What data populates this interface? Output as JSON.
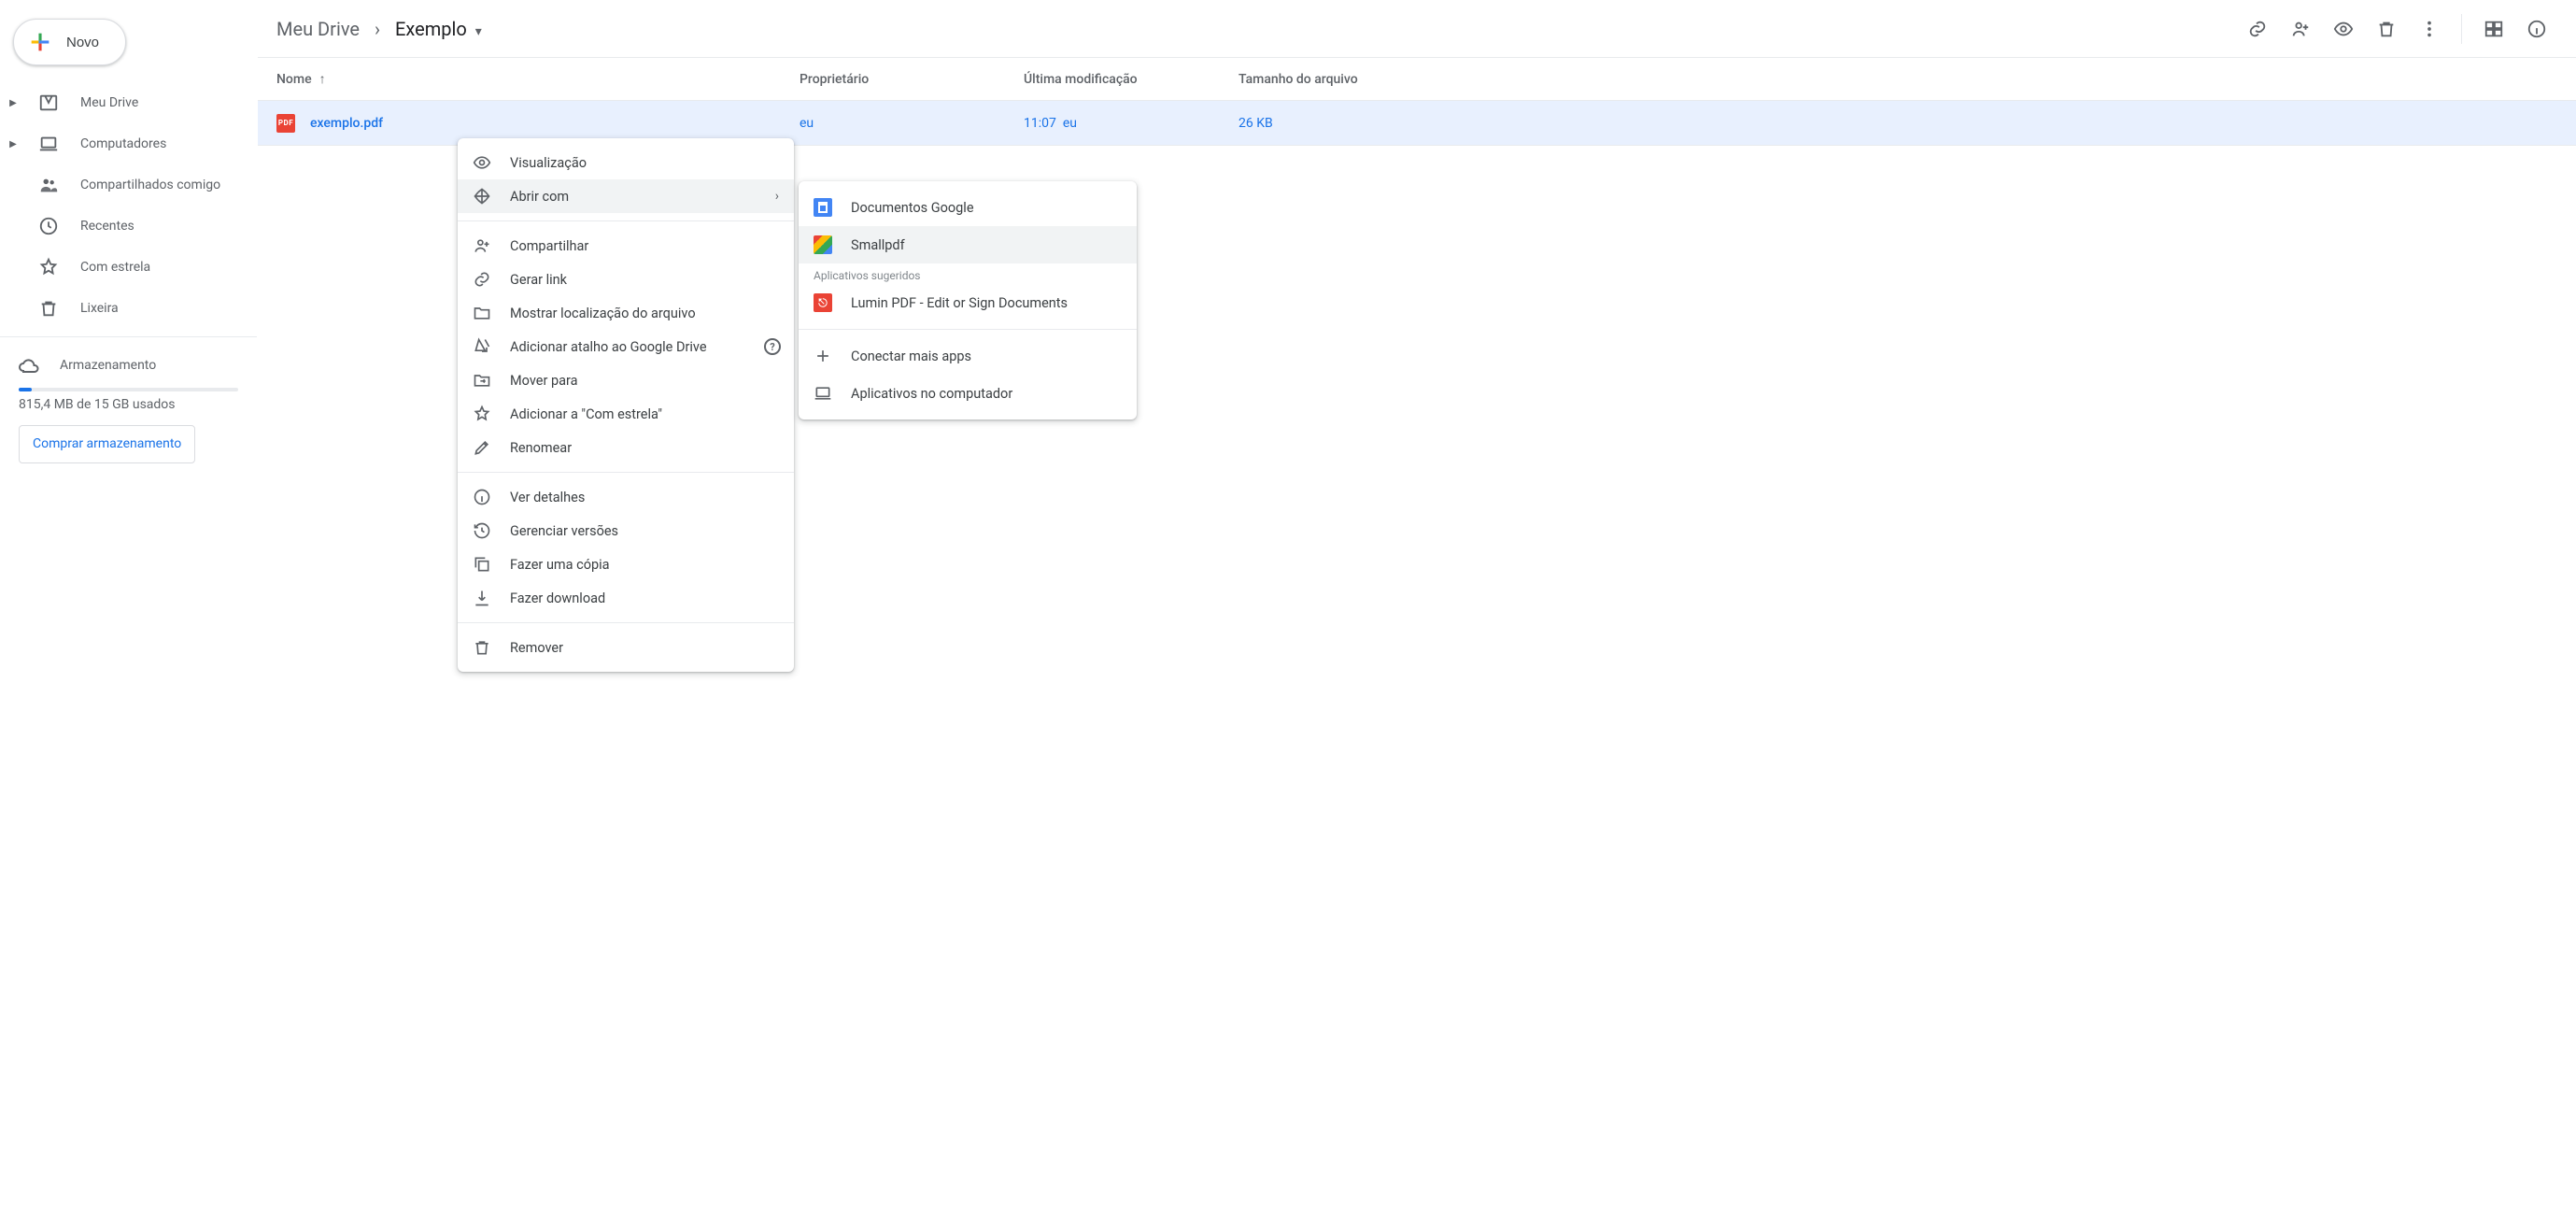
{
  "new_button_label": "Novo",
  "sidebar": {
    "items": [
      {
        "label": "Meu Drive"
      },
      {
        "label": "Computadores"
      },
      {
        "label": "Compartilhados comigo"
      },
      {
        "label": "Recentes"
      },
      {
        "label": "Com estrela"
      },
      {
        "label": "Lixeira"
      }
    ],
    "storage_label": "Armazenamento",
    "storage_text": "815,4 MB de 15 GB usados",
    "buy_storage": "Comprar armazenamento"
  },
  "breadcrumb": {
    "root": "Meu Drive",
    "current": "Exemplo"
  },
  "columns": {
    "name": "Nome",
    "owner": "Proprietário",
    "modified": "Última modificação",
    "size": "Tamanho do arquivo"
  },
  "file": {
    "name": "exemplo.pdf",
    "owner": "eu",
    "modified_time": "11:07",
    "modified_by": "eu",
    "size": "26 KB",
    "pdf_badge": "PDF"
  },
  "context_menu": {
    "preview": "Visualização",
    "open_with": "Abrir com",
    "share": "Compartilhar",
    "get_link": "Gerar link",
    "show_location": "Mostrar localização do arquivo",
    "add_shortcut": "Adicionar atalho ao Google Drive",
    "move_to": "Mover para",
    "add_star": "Adicionar a \"Com estrela\"",
    "rename": "Renomear",
    "details": "Ver detalhes",
    "versions": "Gerenciar versões",
    "copy": "Fazer uma cópia",
    "download": "Fazer download",
    "remove": "Remover"
  },
  "submenu": {
    "docs": "Documentos Google",
    "smallpdf": "Smallpdf",
    "suggested_heading": "Aplicativos sugeridos",
    "lumin": "Lumin PDF - Edit or Sign Documents",
    "connect_more": "Conectar mais apps",
    "on_computer": "Aplicativos no computador"
  }
}
